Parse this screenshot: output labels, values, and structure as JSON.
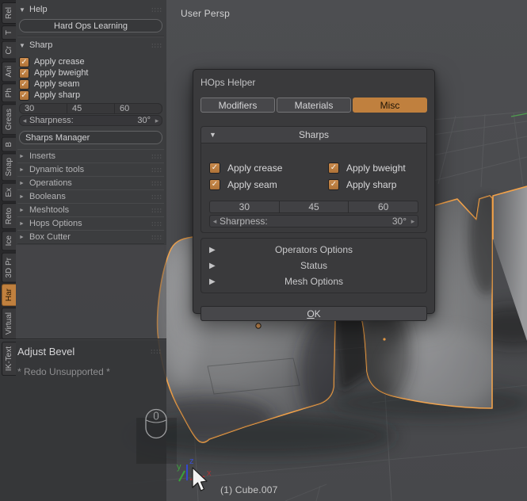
{
  "icons": {
    "panel_open": "▼",
    "panel_closed": "►",
    "row_closed": "▶",
    "slider_prev": "◂",
    "slider_next": "▸",
    "check": "✓",
    "grip": "::::"
  },
  "colors": {
    "accent_orange": "#c0803e",
    "selection_outline": "#f2a24a",
    "checkbox_orange": "#bd7f42",
    "axis_x": "#a93434",
    "axis_y": "#3fa23f",
    "axis_z": "#3a4ed0"
  },
  "viewport": {
    "view_label": "User Persp",
    "object_label": "(1) Cube.007",
    "axis_labels": {
      "x": "x",
      "y": "y",
      "z": "z"
    }
  },
  "tab_strip": {
    "tabs": [
      {
        "label": "Rel",
        "active": false
      },
      {
        "label": "T",
        "active": false
      },
      {
        "label": "Cr",
        "active": false
      },
      {
        "label": "Ani",
        "active": false
      },
      {
        "label": "Ph",
        "active": false
      },
      {
        "label": "Greas",
        "active": false
      },
      {
        "label": "B",
        "active": false
      },
      {
        "label": "Snap",
        "active": false
      },
      {
        "label": "Ex",
        "active": false
      },
      {
        "label": "Reto",
        "active": false
      },
      {
        "label": "Ice",
        "active": false
      },
      {
        "label": "3D Pr",
        "active": false
      },
      {
        "label": "Har",
        "active": true
      },
      {
        "label": "Virtual",
        "active": false
      },
      {
        "label": "IK-Text",
        "active": false
      }
    ]
  },
  "tool_shelf": {
    "help_panel": {
      "title": "Help",
      "learning_button": "Hard Ops Learning"
    },
    "sharp_panel": {
      "title": "Sharp",
      "checkboxes": [
        {
          "label": "Apply crease",
          "checked": true
        },
        {
          "label": "Apply bweight",
          "checked": true
        },
        {
          "label": "Apply seam",
          "checked": true
        },
        {
          "label": "Apply sharp",
          "checked": true
        }
      ],
      "presets": [
        "30",
        "45",
        "60"
      ],
      "slider": {
        "label": "Sharpness:",
        "value": "30°"
      },
      "manager_button": "Sharps Manager"
    },
    "collapsed_panels": [
      "Inserts",
      "Dynamic tools",
      "Operations",
      "Booleans",
      "Meshtools",
      "Hops Options",
      "Box Cutter"
    ],
    "adjust_panel": {
      "title": "Adjust Bevel",
      "status": "* Redo Unsupported *"
    }
  },
  "popup": {
    "title": "HOps Helper",
    "tabs": [
      {
        "label": "Modifiers",
        "active": false
      },
      {
        "label": "Materials",
        "active": false
      },
      {
        "label": "Misc",
        "active": true
      }
    ],
    "sharps_section": {
      "title": "Sharps",
      "checkboxes": [
        {
          "label": "Apply crease",
          "checked": true
        },
        {
          "label": "Apply bweight",
          "checked": true
        },
        {
          "label": "Apply seam",
          "checked": true
        },
        {
          "label": "Apply sharp",
          "checked": true
        }
      ],
      "presets": [
        "30",
        "45",
        "60"
      ],
      "slider": {
        "label": "Sharpness:",
        "value": "30°"
      }
    },
    "collapsed_sections": [
      "Operators Options",
      "Status",
      "Mesh Options"
    ],
    "ok_button": "OK"
  }
}
